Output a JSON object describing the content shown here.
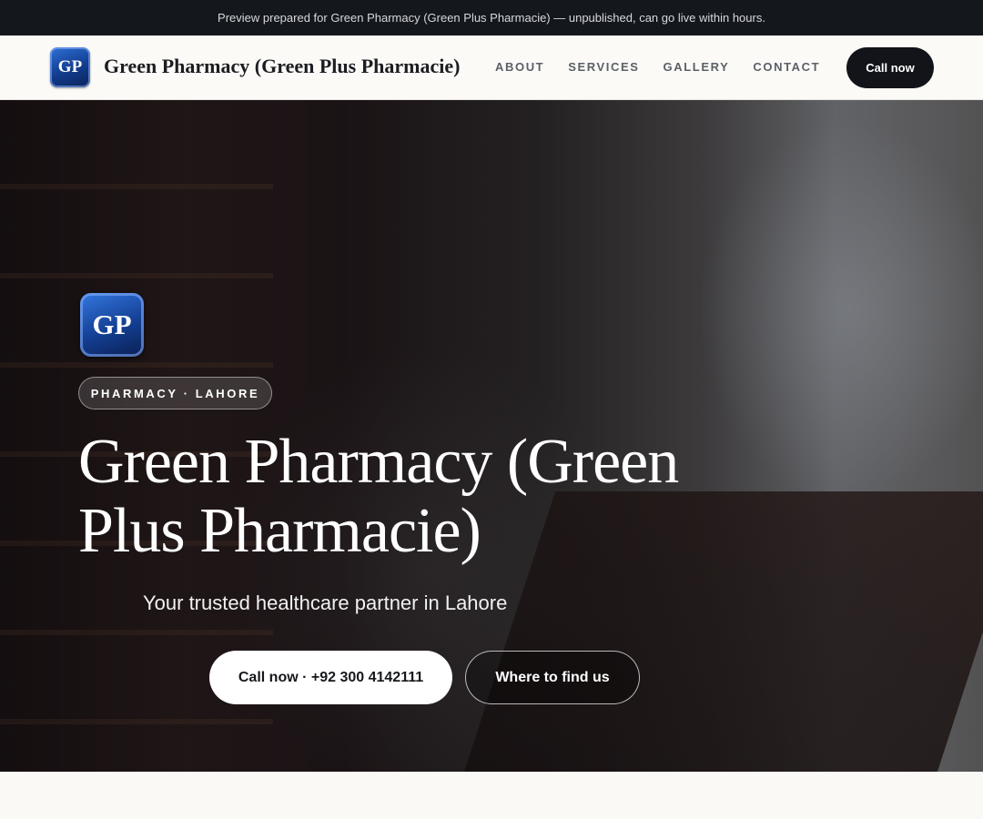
{
  "preview_bar": {
    "text": "Preview prepared for Green Pharmacy (Green Plus Pharmacie) — unpublished, can go live within hours."
  },
  "header": {
    "logo_text": "GP",
    "brand_name": "Green Pharmacy (Green Plus Pharmacie)",
    "nav": [
      {
        "label": "ABOUT"
      },
      {
        "label": "SERVICES"
      },
      {
        "label": "GALLERY"
      },
      {
        "label": "CONTACT"
      }
    ],
    "cta_label": "Call now"
  },
  "hero": {
    "logo_text": "GP",
    "badge": "PHARMACY · LAHORE",
    "title": "Green Pharmacy (Green Plus Pharmacie)",
    "tagline": "Your trusted healthcare partner in Lahore",
    "primary_button": "Call now · +92 300 4142111",
    "secondary_button": "Where to find us"
  },
  "colors": {
    "preview_bar_bg": "#14171c",
    "header_bg": "#fbfaf7",
    "cta_bg": "#121419",
    "logo_blue": "#143f93"
  }
}
